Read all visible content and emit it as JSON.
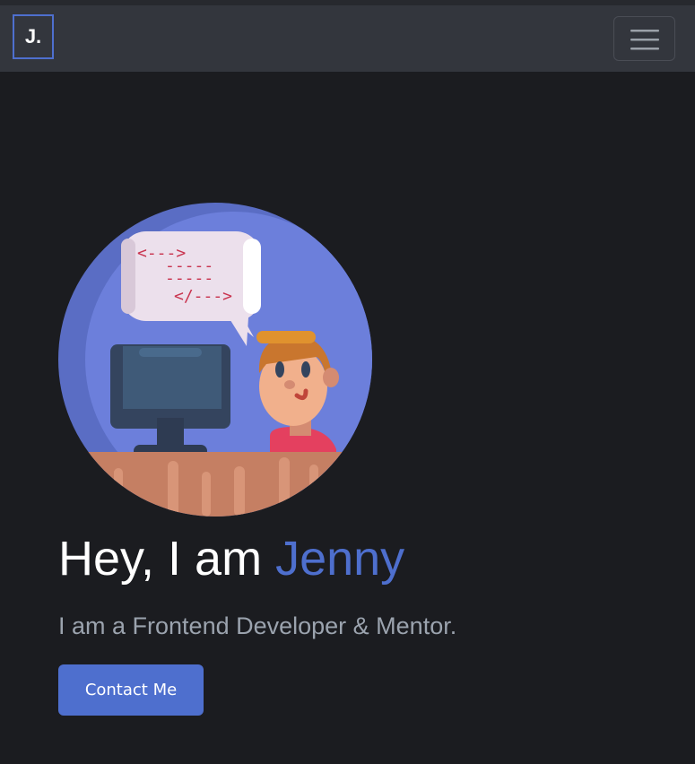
{
  "navbar": {
    "brand": "J.",
    "toggler_icon": "hamburger-menu-icon"
  },
  "hero": {
    "illustration": "developer-at-computer-illustration",
    "code_lines": [
      "<--->",
      "-----",
      "-----",
      "</--->"
    ],
    "title_prefix": "Hey, I am ",
    "title_name": "Jenny",
    "subtitle": "I am a Frontend Developer & Mentor.",
    "cta_label": "Contact Me"
  },
  "colors": {
    "background": "#1b1c20",
    "navbar": "#33363d",
    "accent": "#4e6fce",
    "subtitle": "#9ba3ae"
  }
}
